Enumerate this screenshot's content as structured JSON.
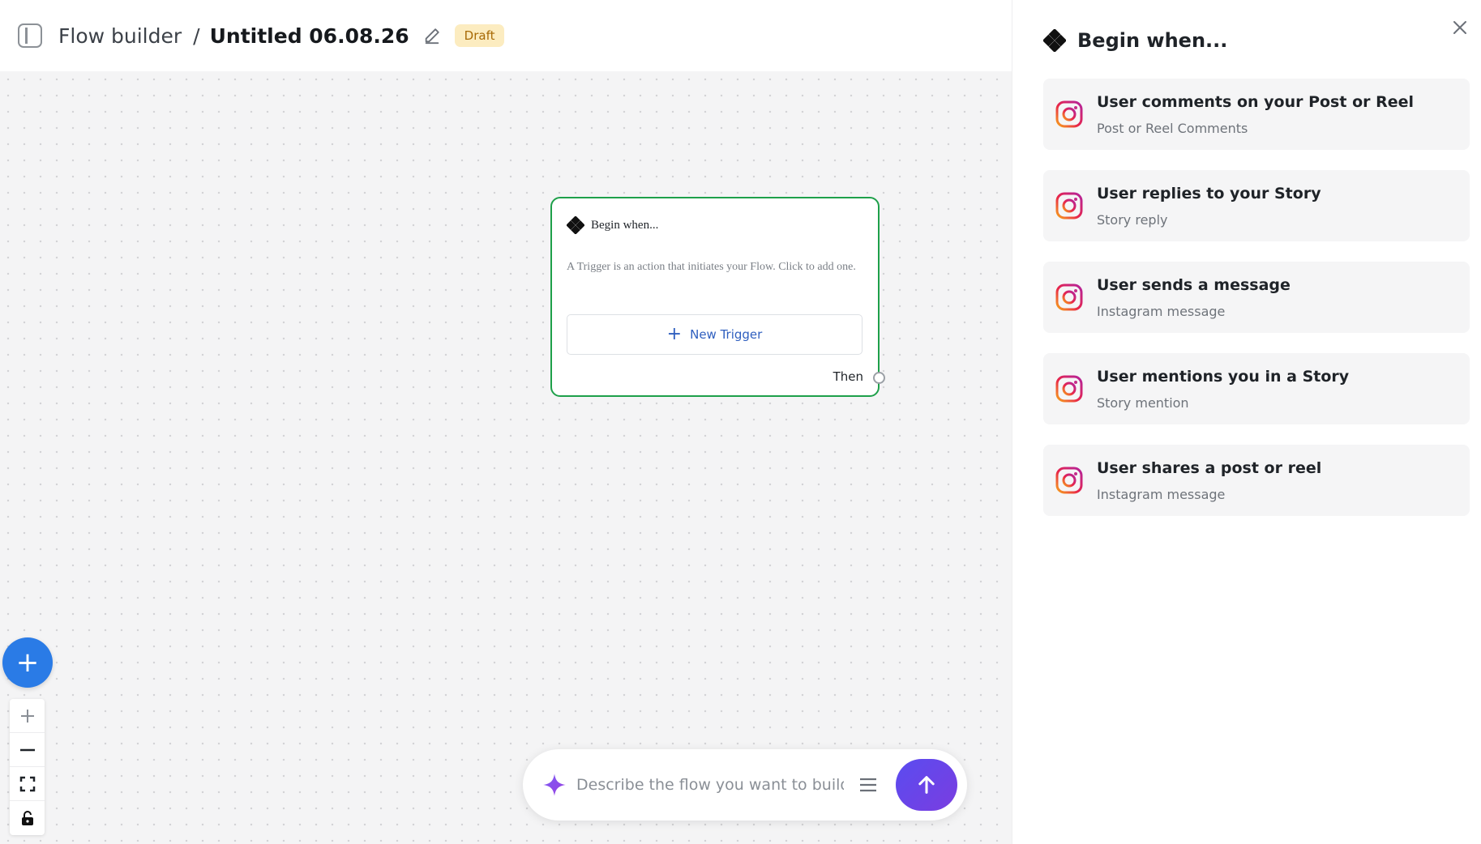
{
  "header": {
    "breadcrumb_root": "Flow builder",
    "separator": "/",
    "flow_title": "Untitled 06.08.26",
    "status_badge": "Draft"
  },
  "canvas": {
    "trigger_node": {
      "title": "Begin when...",
      "description": "A Trigger is an action that initiates your Flow. Click to add one.",
      "new_trigger_label": "New Trigger",
      "then_label": "Then"
    },
    "prompt": {
      "placeholder": "Describe the flow you want to build..."
    },
    "zoom_controls": [
      "zoom-in",
      "zoom-out",
      "fit-view",
      "lock"
    ]
  },
  "panel": {
    "title": "Begin when...",
    "triggers": [
      {
        "title": "User comments on your Post or Reel",
        "subtitle": "Post or Reel Comments",
        "icon": "instagram-icon"
      },
      {
        "title": "User replies to your Story",
        "subtitle": "Story reply",
        "icon": "instagram-icon"
      },
      {
        "title": "User sends a message",
        "subtitle": "Instagram message",
        "icon": "instagram-icon"
      },
      {
        "title": "User mentions you in a Story",
        "subtitle": "Story mention",
        "icon": "instagram-icon"
      },
      {
        "title": "User shares a post or reel",
        "subtitle": "Instagram message",
        "icon": "instagram-icon"
      }
    ]
  },
  "colors": {
    "node_border": "#1ea04a",
    "fab": "#2a7be6",
    "send_button": "#5a4cf0",
    "badge_bg": "#fcecc0",
    "badge_text": "#a86a06",
    "link_blue": "#2f5fbf"
  }
}
